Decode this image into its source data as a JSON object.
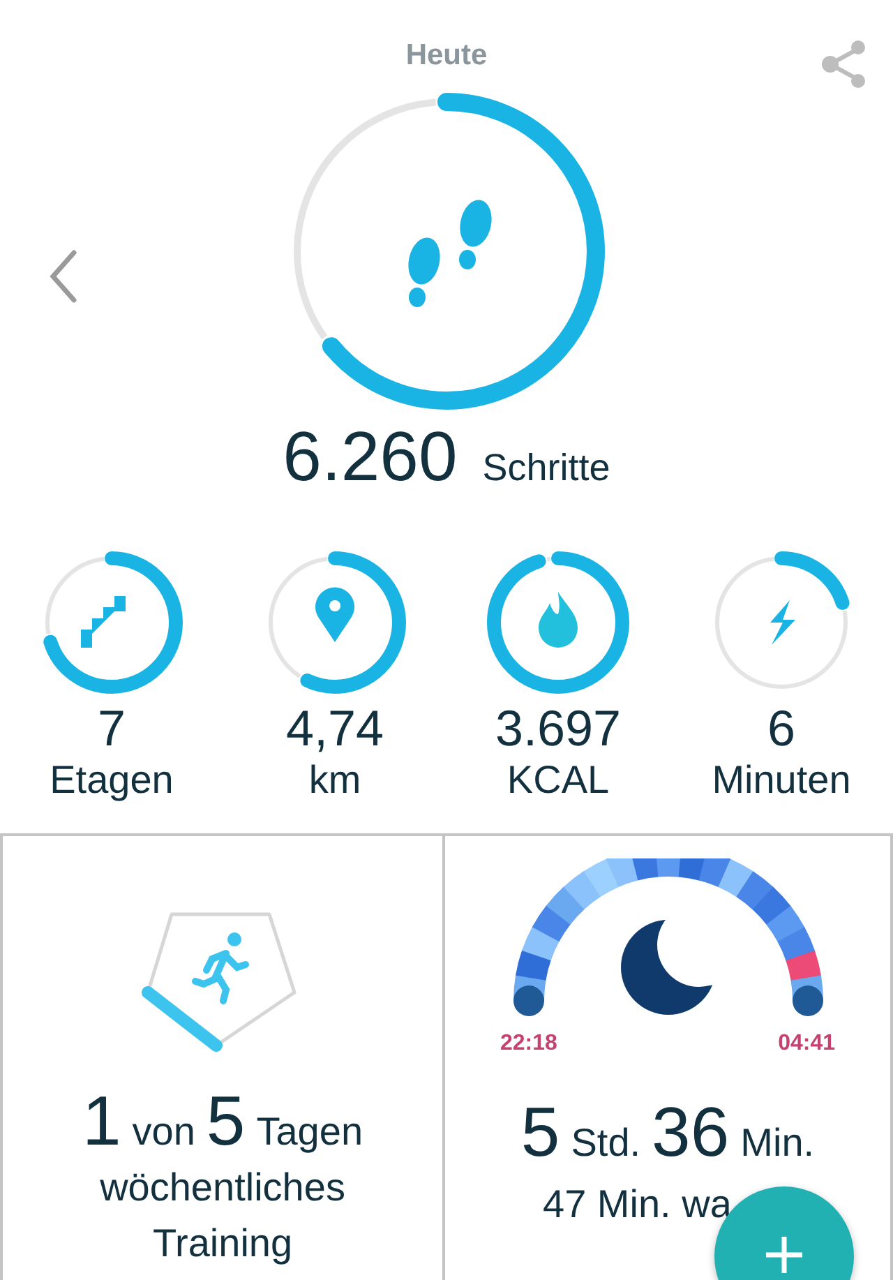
{
  "header": {
    "title": "Heute"
  },
  "steps": {
    "value": "6.260",
    "unit": "Schritte"
  },
  "stats": [
    {
      "kind": "floors",
      "value": "7",
      "label": "Etagen"
    },
    {
      "kind": "distance",
      "value": "4,74",
      "label": "km"
    },
    {
      "kind": "calories",
      "value": "3.697",
      "label": "KCAL"
    },
    {
      "kind": "minutes",
      "value": "6",
      "label": "Minuten"
    }
  ],
  "exercise": {
    "count": "1",
    "of": "von",
    "goal": "5",
    "unit": "Tagen",
    "label": "wöchentliches Training"
  },
  "sleep": {
    "start": "22:18",
    "end": "04:41",
    "hours": "5",
    "hours_unit": "Std.",
    "minutes": "36",
    "minutes_unit": "Min.",
    "awake": "47 Min. wa"
  }
}
